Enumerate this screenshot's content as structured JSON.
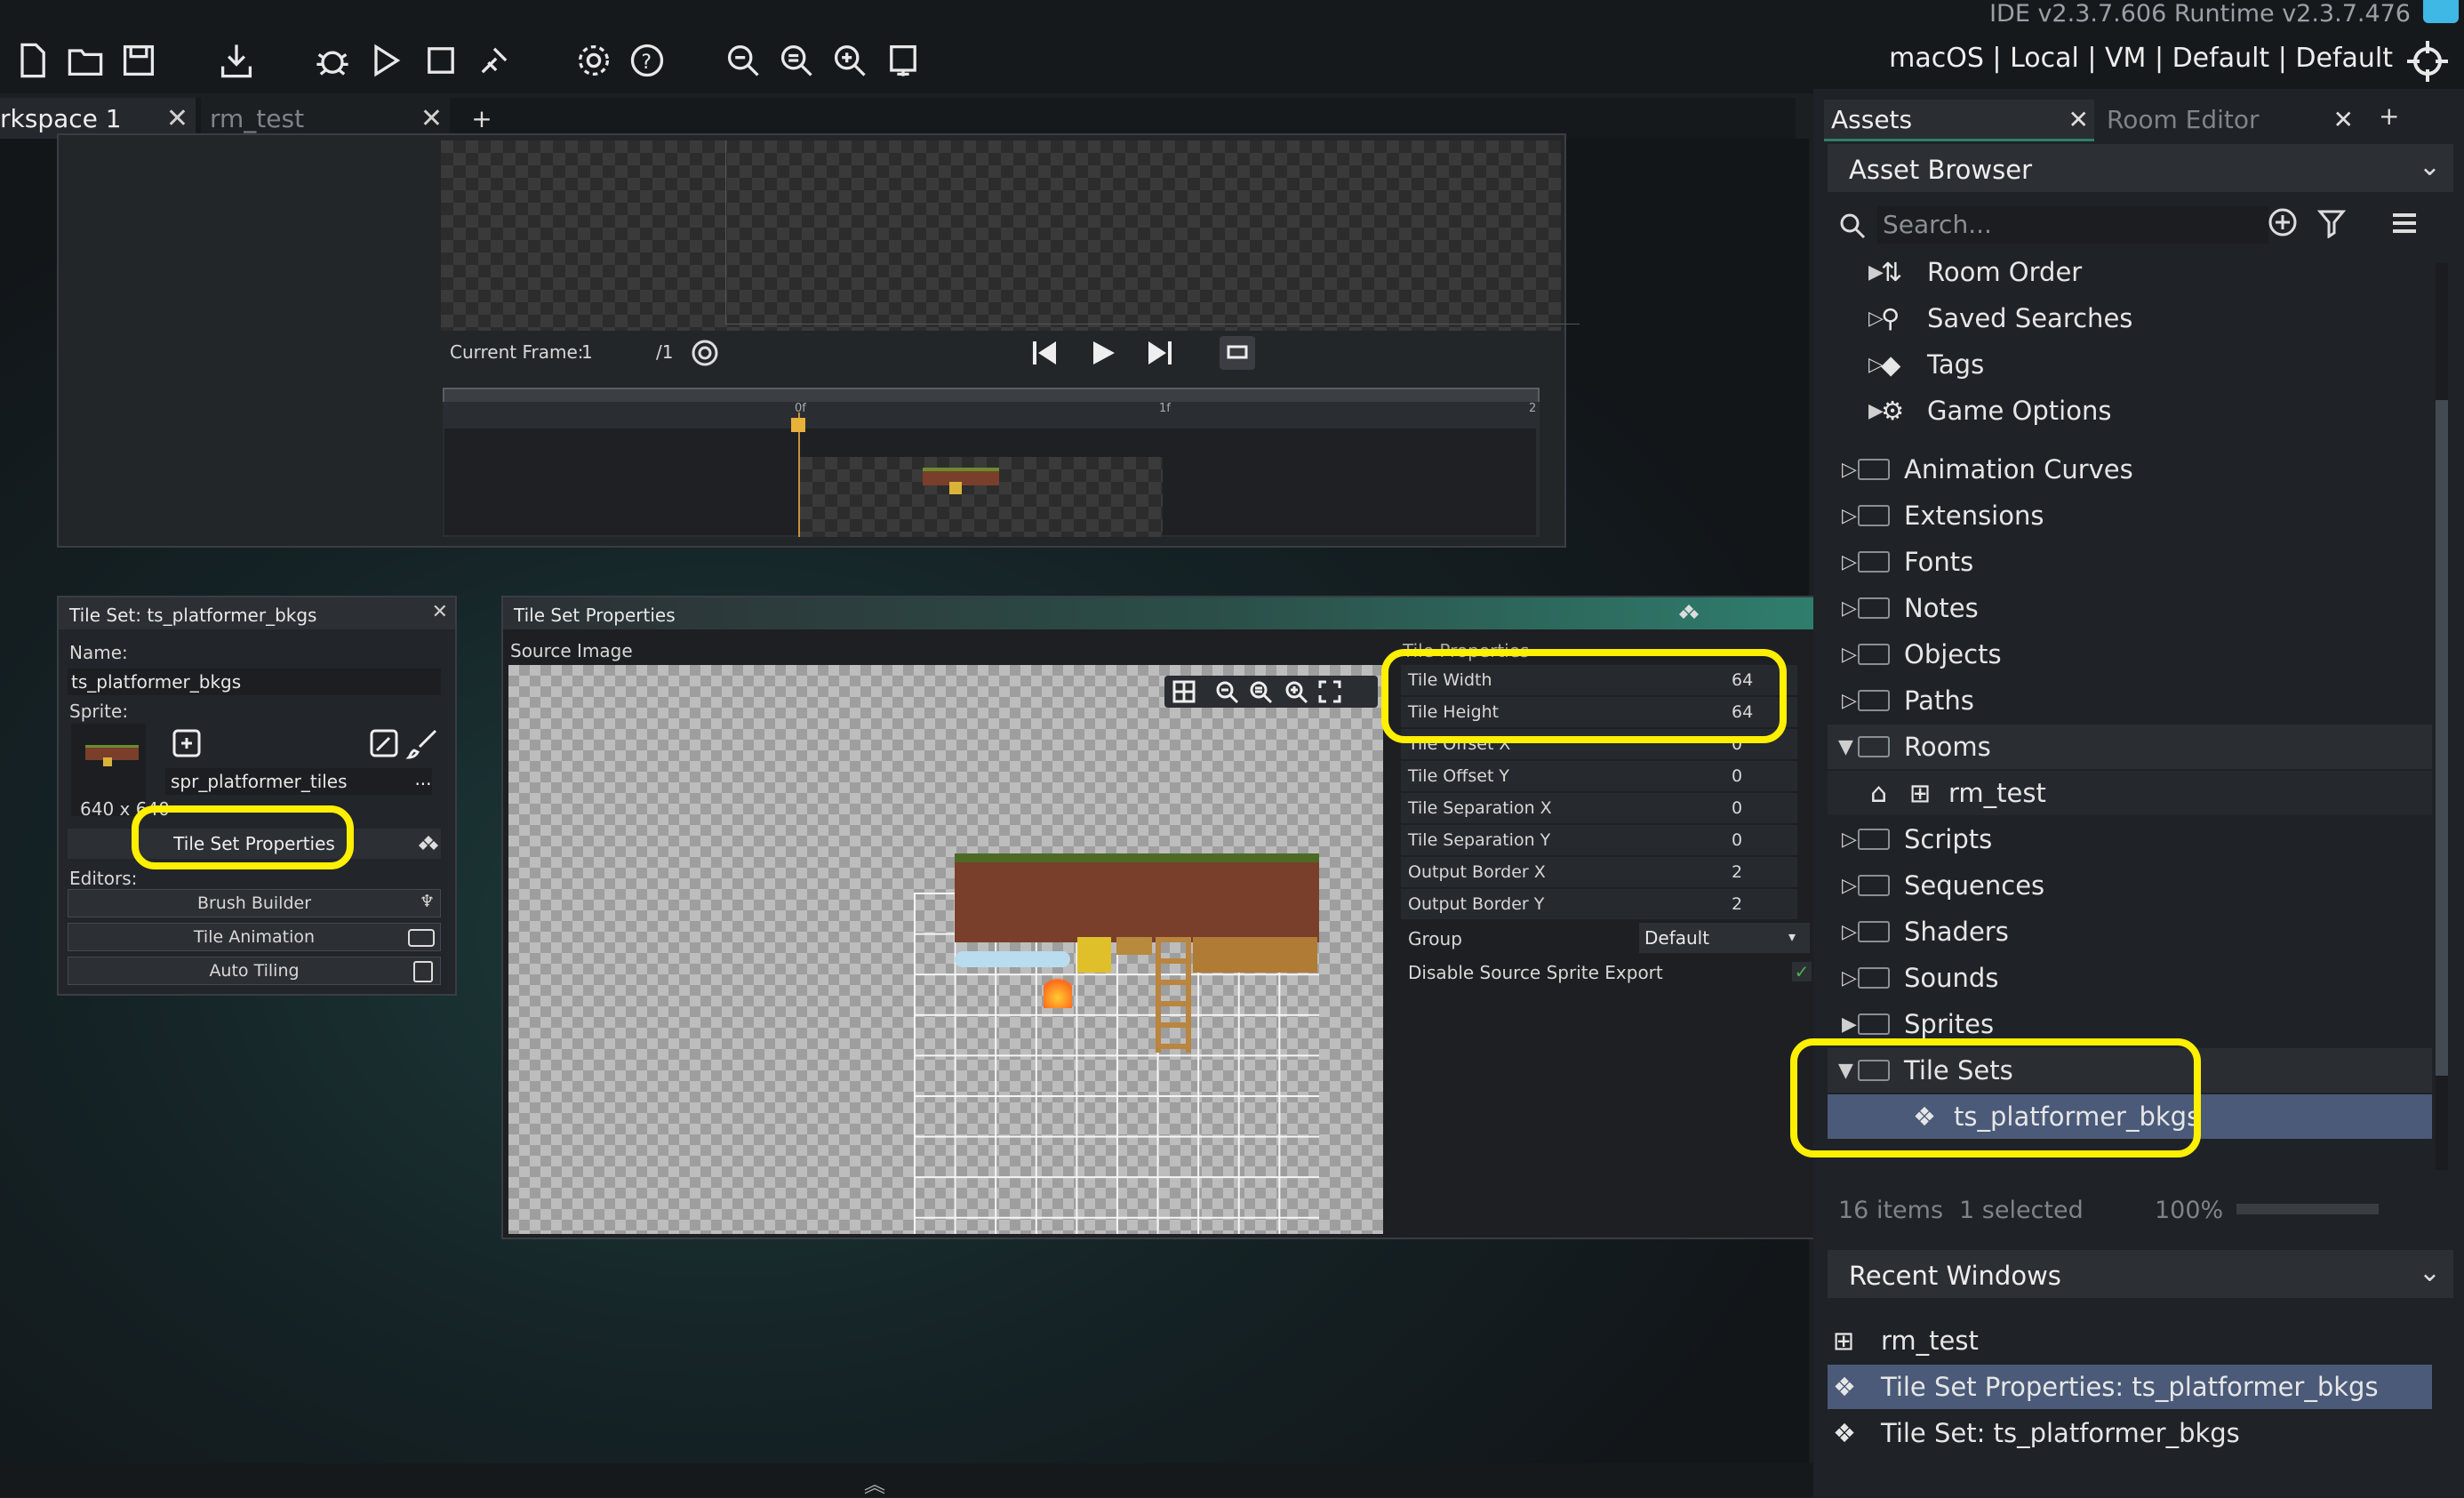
{
  "app": {
    "version": "IDE v2.3.7.606  Runtime v2.3.7.476",
    "target": "macOS | Local | VM | Default | Default"
  },
  "toolbar": {
    "icons": [
      "new-file-icon",
      "open-folder-icon",
      "save-icon",
      "export-icon",
      "debug-icon",
      "run-icon",
      "stop-icon",
      "clean-icon",
      "settings-icon",
      "help-icon",
      "zoom-out-icon",
      "zoom-reset-icon",
      "zoom-in-icon",
      "fit-icon"
    ]
  },
  "doc_tabs": [
    {
      "label": "rkspace 1"
    },
    {
      "label": "rm_test"
    },
    {
      "label": "+"
    }
  ],
  "sprite_preview": {
    "current_frame_label": "Current Frame:",
    "current_frame": "1",
    "frame_total": "/1",
    "timeline_ticks": [
      "0f",
      "1f",
      "2"
    ]
  },
  "tileset_panel": {
    "title": "Tile Set: ts_platformer_bkgs",
    "name_label": "Name:",
    "name_value": "ts_platformer_bkgs",
    "sprite_label": "Sprite:",
    "sprite_value": "spr_platformer_tiles",
    "sprite_more": "...",
    "dimensions": "640 x 640",
    "props_button": "Tile Set Properties",
    "editors_label": "Editors:",
    "editors": [
      "Brush Builder",
      "Tile Animation",
      "Auto Tiling"
    ]
  },
  "tileset_props": {
    "title": "Tile Set Properties",
    "source_image_label": "Source Image",
    "section_label": "Tile Properties",
    "rows": [
      {
        "label": "Tile Width",
        "value": "64"
      },
      {
        "label": "Tile Height",
        "value": "64"
      },
      {
        "label": "Tile Offset X",
        "value": "0"
      },
      {
        "label": "Tile Offset Y",
        "value": "0"
      },
      {
        "label": "Tile Separation X",
        "value": "0"
      },
      {
        "label": "Tile Separation Y",
        "value": "0"
      },
      {
        "label": "Output Border X",
        "value": "2"
      },
      {
        "label": "Output Border Y",
        "value": "2"
      }
    ],
    "group_label": "Group",
    "group_value": "Default",
    "disable_export_label": "Disable Source Sprite Export"
  },
  "assets": {
    "tab_assets": "Assets",
    "tab_room_editor": "Room Editor",
    "tab_add": "+",
    "browser_title": "Asset Browser",
    "search_placeholder": "Search...",
    "special_items": [
      {
        "label": "Room Order",
        "icon": "room-order-icon"
      },
      {
        "label": "Saved Searches",
        "icon": "search-icon"
      },
      {
        "label": "Tags",
        "icon": "tag-icon"
      },
      {
        "label": "Game Options",
        "icon": "gear-icon"
      }
    ],
    "folders": [
      {
        "label": "Animation Curves"
      },
      {
        "label": "Extensions"
      },
      {
        "label": "Fonts"
      },
      {
        "label": "Notes"
      },
      {
        "label": "Objects"
      },
      {
        "label": "Paths"
      },
      {
        "label": "Rooms"
      },
      {
        "label": "rm_test"
      },
      {
        "label": "Scripts"
      },
      {
        "label": "Sequences"
      },
      {
        "label": "Shaders"
      },
      {
        "label": "Sounds"
      },
      {
        "label": "Sprites"
      },
      {
        "label": "Tile Sets"
      },
      {
        "label": "ts_platformer_bkgs"
      }
    ],
    "status_items": "16 items",
    "status_selected": "1 selected",
    "zoom": "100%",
    "recent_title": "Recent Windows",
    "recent": [
      {
        "label": "rm_test"
      },
      {
        "label": "Tile Set Properties: ts_platformer_bkgs"
      },
      {
        "label": "Tile Set: ts_platformer_bkgs"
      }
    ]
  },
  "colors": {
    "highlight": "#ffef00",
    "accent_green": "#2f7e6e",
    "selected_row": "#4a5a78"
  }
}
